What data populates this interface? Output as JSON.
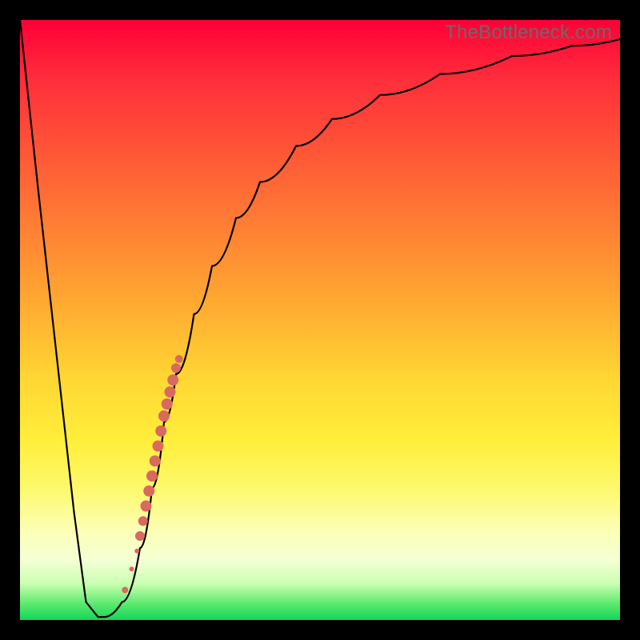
{
  "watermark": "TheBottleneck.com",
  "colors": {
    "frame": "#000000",
    "curve": "#000000",
    "highlight": "#d86a5f",
    "gradient_top": "#ff0038",
    "gradient_bottom": "#11d65a"
  },
  "chart_data": {
    "type": "line",
    "title": "",
    "xlabel": "",
    "ylabel": "",
    "xlim": [
      0,
      100
    ],
    "ylim": [
      0,
      100
    ],
    "grid": false,
    "legend": false,
    "series": [
      {
        "name": "bottleneck-curve",
        "x": [
          0,
          3,
          6,
          9,
          11,
          13,
          14,
          17,
          20,
          22,
          24,
          26,
          29,
          32,
          36,
          40,
          46,
          52,
          60,
          70,
          82,
          92,
          100
        ],
        "values": [
          100,
          72,
          45,
          18,
          3,
          0.5,
          0.5,
          3,
          12,
          22,
          33,
          41,
          51,
          59,
          67,
          73,
          79,
          83.5,
          87.5,
          91,
          94,
          95.7,
          96.8
        ]
      }
    ],
    "highlighted_points": {
      "name": "marked-segment",
      "x": [
        17.5,
        18.6,
        19.5,
        20.0,
        20.5,
        21.0,
        21.5,
        22.0,
        22.5,
        23.0,
        23.5,
        24.0,
        24.5,
        25.0,
        25.5,
        26.0,
        26.5
      ],
      "values": [
        5.0,
        8.5,
        11.5,
        14.0,
        16.5,
        19.0,
        21.5,
        24.0,
        26.5,
        29.0,
        31.5,
        34.0,
        36.0,
        38.0,
        40.0,
        42.0,
        43.5
      ],
      "radius": [
        4,
        3,
        3,
        6,
        6,
        7,
        7,
        7,
        7,
        7,
        7,
        7,
        7,
        7,
        7,
        6,
        5
      ]
    }
  }
}
